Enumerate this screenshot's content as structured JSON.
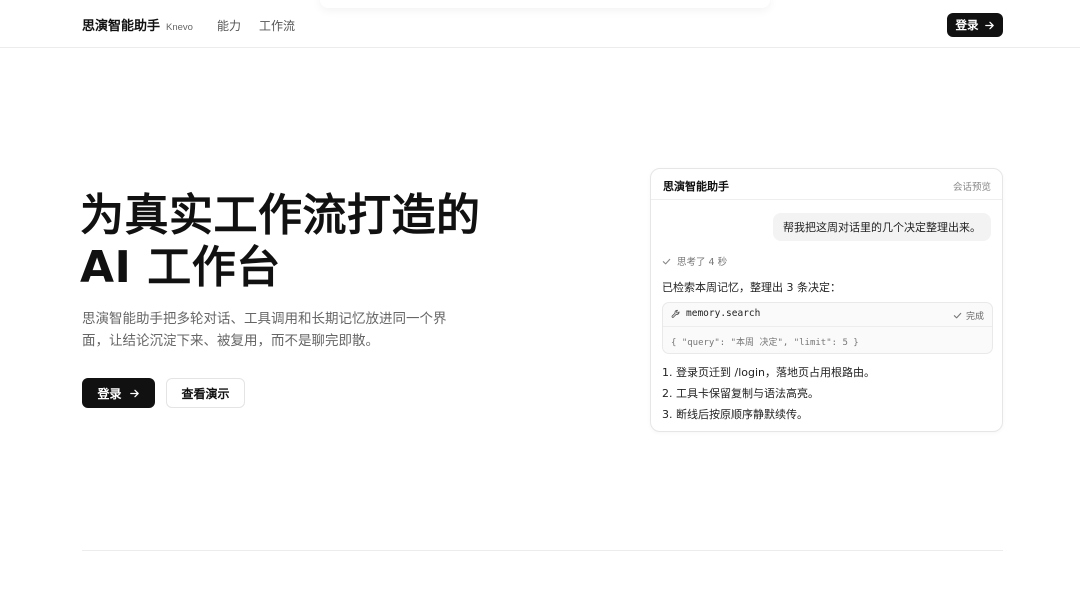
{
  "nav": {
    "brand": "思演智能助手",
    "brand_sub": "Knevo",
    "links": [
      "能力",
      "工作流"
    ],
    "login_label": "登录"
  },
  "hero": {
    "title_line1": "为真实工作流打造的",
    "title_line2": "AI 工作台",
    "description": "思演智能助手把多轮对话、工具调用和长期记忆放进同一个界面，让结论沉淀下来、被复用，而不是聊完即散。",
    "primary_label": "登录",
    "secondary_label": "查看演示"
  },
  "chat": {
    "title": "思演智能助手",
    "tag": "会话预览",
    "user_message": "帮我把这周对话里的几个决定整理出来。",
    "thinking": "思考了 4 秒",
    "reply_lead": "已检索本周记忆，整理出 3 条决定：",
    "tool": {
      "name": "memory.search",
      "status": "完成",
      "args": "{ \"query\": \"本周 决定\", \"limit\": 5 }"
    },
    "decisions": [
      "1. 登录页迁到 /login，落地页占用根路由。",
      "2. 工具卡保留复制与语法高亮。",
      "3. 断线后按原顺序静默续传。"
    ]
  },
  "icons": {
    "arrow": "arrow-right-icon",
    "check": "check-icon",
    "tool": "wrench-icon"
  },
  "colors": {
    "primary": "#111111",
    "muted": "#666666",
    "border": "#e6e6e6"
  }
}
